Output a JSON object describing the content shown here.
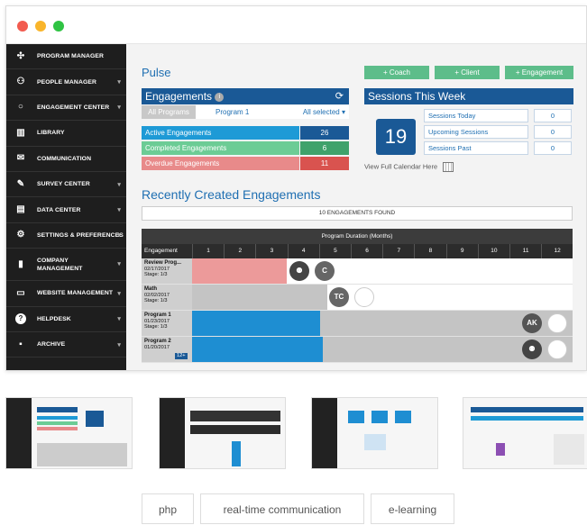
{
  "sidebar": {
    "items": [
      {
        "label": "PROGRAM MANAGER",
        "icon": "network-icon",
        "caret": false
      },
      {
        "label": "PEOPLE MANAGER",
        "icon": "people-icon",
        "caret": true
      },
      {
        "label": "ENGAGEMENT CENTER",
        "icon": "circle-icon",
        "caret": true
      },
      {
        "label": "LIBRARY",
        "icon": "books-icon",
        "caret": false
      },
      {
        "label": "COMMUNICATION",
        "icon": "envelope-icon",
        "caret": false
      },
      {
        "label": "SURVEY CENTER",
        "icon": "edit-icon",
        "caret": true
      },
      {
        "label": "DATA CENTER",
        "icon": "monitor-chart-icon",
        "caret": true
      },
      {
        "label": "SETTINGS & PREFERENCES",
        "icon": "gear-icon",
        "caret": true
      },
      {
        "label": "COMPANY MANAGEMENT",
        "icon": "building-icon",
        "caret": true
      },
      {
        "label": "WEBSITE MANAGEMENT",
        "icon": "monitor-icon",
        "caret": true
      },
      {
        "label": "HELPDESK",
        "icon": "help-icon",
        "caret": true
      },
      {
        "label": "ARCHIVE",
        "icon": "archive-icon",
        "caret": true
      }
    ]
  },
  "main": {
    "title": "Pulse",
    "buttons": {
      "coach": "+ Coach",
      "client": "+ Client",
      "engagement": "+ Engagement"
    },
    "engagements": {
      "title": "Engagements",
      "tab_all": "All Programs",
      "tab_program": "Program 1",
      "tab_selected": "All selected",
      "rows": [
        {
          "label": "Active Engagements",
          "value": "26"
        },
        {
          "label": "Completed Engagements",
          "value": "6"
        },
        {
          "label": "Overdue Engagements",
          "value": "11"
        }
      ]
    },
    "sessions": {
      "title": "Sessions This Week",
      "calendar_day": "19",
      "rows": [
        {
          "label": "Sessions Today",
          "value": "0"
        },
        {
          "label": "Upcoming Sessions",
          "value": "0"
        },
        {
          "label": "Sessions Past",
          "value": "0"
        }
      ],
      "calendar_link": "View Full Calendar Here"
    },
    "recent": {
      "title": "Recently Created Engagements",
      "found": "10 ENGAGEMENTS FOUND",
      "gantt_title": "Program Duration (Months)",
      "col_engagement": "Engagement",
      "months": [
        "1",
        "2",
        "3",
        "4",
        "5",
        "6",
        "7",
        "8",
        "9",
        "10",
        "11",
        "12"
      ],
      "rows": [
        {
          "name": "Review Prog...",
          "date": "02/17/2017",
          "stage": "Stage: 1/3"
        },
        {
          "name": "Math",
          "date": "02/02/2017",
          "stage": "Stage: 1/3"
        },
        {
          "name": "Program 1",
          "date": "01/23/2017",
          "stage": "Stage: 1/3"
        },
        {
          "name": "Program 2",
          "date": "01/20/2017",
          "stage": ""
        }
      ],
      "avatars": {
        "c": "C",
        "tc": "TC",
        "ak": "AK",
        "badge": "12+"
      }
    }
  },
  "tags": [
    "php",
    "real-time communication",
    "e-learning"
  ],
  "colors": {
    "sidebar": "#1e1e1e",
    "brand_blue": "#1a5996",
    "accent_green": "#5dbd8a",
    "overdue_red": "#e88a8a",
    "active_blue": "#1e9ad6"
  }
}
